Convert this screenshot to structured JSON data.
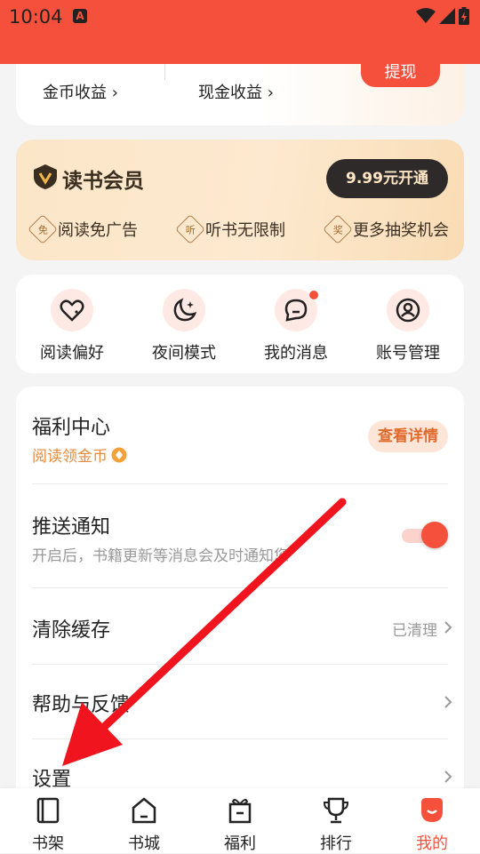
{
  "status_bar": {
    "time": "10:04",
    "app_badge": "A"
  },
  "earnings": {
    "gold_label": "金币收益",
    "cash_label": "现金收益",
    "withdraw_label": "提现"
  },
  "vip": {
    "title": "读书会员",
    "button_label": "9.99元开通",
    "benefits": [
      {
        "badge": "免",
        "label": "阅读免广告"
      },
      {
        "badge": "听",
        "label": "听书无限制"
      },
      {
        "badge": "奖",
        "label": "更多抽奖机会"
      }
    ]
  },
  "shortcuts": [
    {
      "label": "阅读偏好",
      "icon": "heart-chat-icon"
    },
    {
      "label": "夜间模式",
      "icon": "moon-icon"
    },
    {
      "label": "我的消息",
      "icon": "message-icon",
      "has_dot": true
    },
    {
      "label": "账号管理",
      "icon": "account-icon"
    }
  ],
  "settings": {
    "welfare": {
      "title": "福利中心",
      "subtitle": "阅读领金币",
      "button": "查看详情"
    },
    "push": {
      "title": "推送通知",
      "subtitle": "开启后，书籍更新等消息会及时通知您",
      "enabled": true
    },
    "cache": {
      "title": "清除缓存",
      "value": "已清理"
    },
    "help": {
      "title": "帮助与反馈"
    },
    "settings": {
      "title": "设置"
    }
  },
  "bottom_nav": [
    {
      "label": "书架",
      "active": false
    },
    {
      "label": "书城",
      "active": false
    },
    {
      "label": "福利",
      "active": false
    },
    {
      "label": "排行",
      "active": false
    },
    {
      "label": "我的",
      "active": true
    }
  ],
  "colors": {
    "accent": "#f5503c",
    "vip_button": "#2e2a2a",
    "welfare_orange": "#e88a3c"
  }
}
